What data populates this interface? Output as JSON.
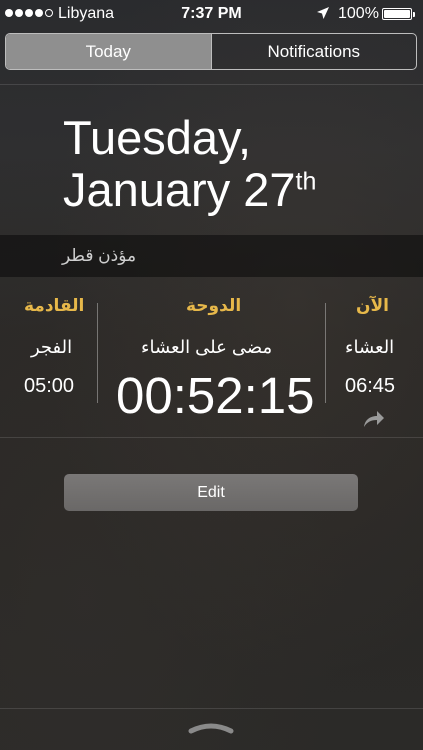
{
  "status_bar": {
    "carrier": "Libyana",
    "time": "7:37 PM",
    "battery_percent": "100%",
    "signal_bars_filled": 4,
    "signal_bars_total": 5
  },
  "segmented_control": {
    "tabs": [
      {
        "label": "Today",
        "selected": true
      },
      {
        "label": "Notifications",
        "selected": false
      }
    ]
  },
  "date": {
    "line1": "Tuesday,",
    "line2": "January 27",
    "suffix": "th"
  },
  "widget": {
    "title": "مؤذن قطر",
    "columns": {
      "next": {
        "label": "القادمة",
        "prayer": "الفجر",
        "time": "05:00"
      },
      "city": {
        "label": "الدوحة",
        "status": "مضى على العشاء",
        "countdown": "00:52:15"
      },
      "now": {
        "label": "الآن",
        "prayer": "العشاء",
        "time": "06:45"
      }
    }
  },
  "edit_button": {
    "label": "Edit"
  },
  "colors": {
    "accent_gold": "#e7b84a",
    "segment_selected": "#8f8f8f",
    "button": "#726f6e"
  },
  "icons": {
    "location": "location-arrow-icon",
    "battery": "battery-icon",
    "share": "share-arrow-icon",
    "grabber": "chevron-grabber-icon"
  }
}
